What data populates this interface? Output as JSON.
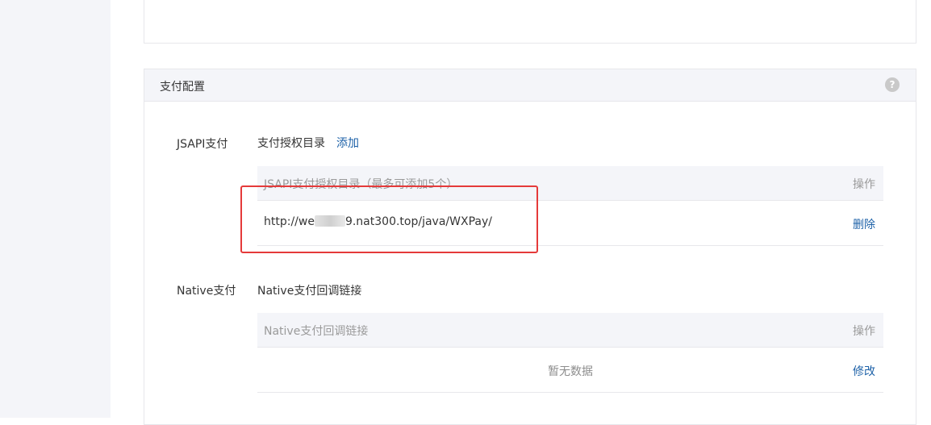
{
  "panel": {
    "title": "支付配置",
    "help_icon": "help-question-icon",
    "help_glyph": "?"
  },
  "jsapi": {
    "label": "JSAPI支付",
    "sub_label": "支付授权目录",
    "add_link": "添加",
    "table": {
      "header_main": "JSAPI支付授权目录（最多可添加5个）",
      "header_op": "操作",
      "rows": [
        {
          "url_prefix": "http://we",
          "url_suffix": "9.nat300.top/java/WXPay/",
          "action": "删除"
        }
      ]
    }
  },
  "native": {
    "label": "Native支付",
    "sub_label": "Native支付回调链接",
    "table": {
      "header_main": "Native支付回调链接",
      "header_op": "操作",
      "empty_text": "暂无数据",
      "action": "修改"
    }
  },
  "colors": {
    "link": "#1e62a8",
    "highlight": "#e53a3a",
    "header_bg": "#f4f5f9"
  }
}
